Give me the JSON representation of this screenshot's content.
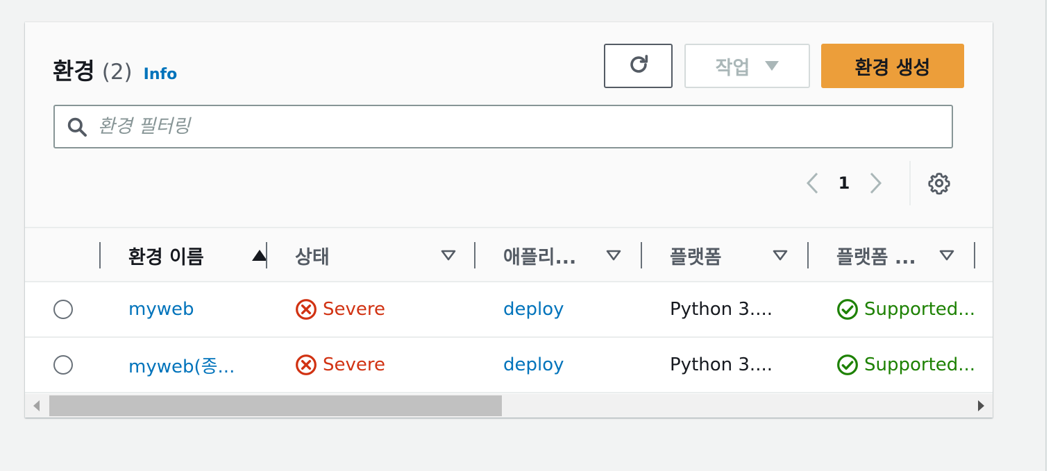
{
  "header": {
    "title": "환경",
    "count": "(2)",
    "info_label": "Info"
  },
  "toolbar": {
    "refresh_icon": "refresh-icon",
    "actions_label": "작업",
    "create_label": "환경 생성"
  },
  "search": {
    "placeholder": "환경 필터링",
    "value": ""
  },
  "pagination": {
    "current_page": "1"
  },
  "table": {
    "columns": [
      {
        "label": "환경 이름",
        "sort": "ascending"
      },
      {
        "label": "상태",
        "sort": "none"
      },
      {
        "label": "애플리...",
        "sort": "none"
      },
      {
        "label": "플랫폼",
        "sort": "none"
      },
      {
        "label": "플랫폼 ...",
        "sort": "none"
      }
    ],
    "rows": [
      {
        "name": "myweb",
        "status": "Severe",
        "application": "deploy",
        "platform": "Python 3....",
        "platform_state": "Supported..."
      },
      {
        "name": "myweb(종...",
        "status": "Severe",
        "application": "deploy",
        "platform": "Python 3....",
        "platform_state": "Supported..."
      }
    ]
  },
  "colors": {
    "primary_button": "#ec9e3a",
    "link": "#0073bb",
    "severe": "#d13212",
    "supported": "#1d8102"
  }
}
